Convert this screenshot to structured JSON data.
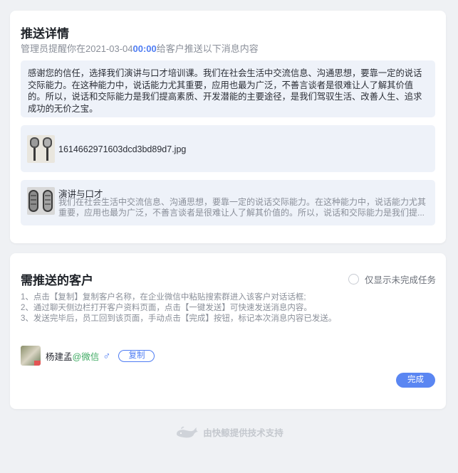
{
  "detail": {
    "title": "推送详情",
    "subtitle_prefix": "管理员提醒你在2021-03-04",
    "subtitle_time": "00:00",
    "subtitle_suffix": "给客户推送以下消息内容",
    "message_text": "感谢您的信任，选择我们演讲与口才培训课。我们在社会生活中交流信息、沟通思想，要靠一定的说话交际能力。在这种能力中，说话能力尤其重要，应用也最为广泛，不善言谈者是很难让人了解其价值的。所以，说话和交际能力是我们提高素质、开发潜能的主要途径，是我们驾驭生活、改善人生、追求成功的无价之宝。",
    "file": {
      "name": "1614662971603dcd3bd89d7.jpg",
      "icon": "microphone-image"
    },
    "link": {
      "title": "演讲与口才",
      "desc_line1": "我们在社会生活中交流信息、沟通思想，要靠一定的说话交际能力。在这种能力中，说话能力尤其",
      "desc_line2": "重要，应用也最为广泛，不善言谈者是很难让人了解其价值的。所以，说话和交际能力是我们提...",
      "icon": "microphone-image"
    }
  },
  "customers": {
    "title": "需推送的客户",
    "toggle_label": "仅显示未完成任务",
    "instructions": [
      "1、点击【复制】复制客户名称，在企业微信中粘贴搜索群进入该客户对话话框;",
      "2、通过聊天侧边栏打开客户资料页面，点击【一键发送】可快速发送消息内容。",
      "3、发送完毕后，员工回到该页面，手动点击【完成】按钮，标记本次消息内容已发送。"
    ],
    "customer": {
      "name": "杨建孟",
      "wechat_tag": "@微信",
      "gender_icon": "♂",
      "copy_label": "复制"
    },
    "done_label": "完成"
  },
  "footer": {
    "text": "由快鲸提供技术支持",
    "icon": "whale-icon"
  },
  "colors": {
    "accent": "#4f7df3",
    "wechat_green": "#3eaa62",
    "panel_bg": "#eef2f9",
    "page_bg": "#eff1f4"
  }
}
